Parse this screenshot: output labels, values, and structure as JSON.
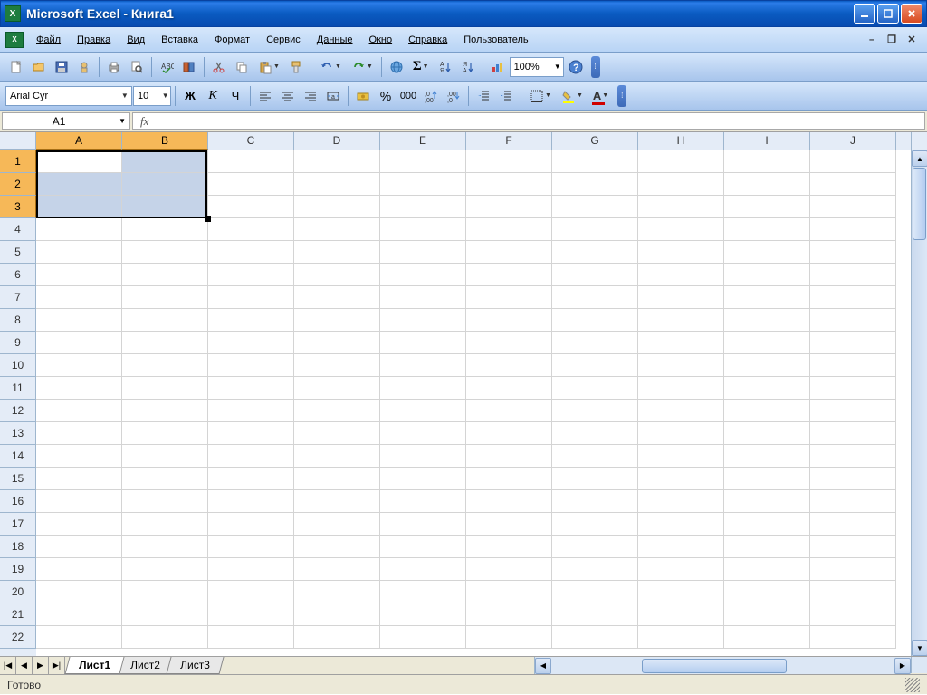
{
  "title": "Microsoft Excel - Книга1",
  "menu": {
    "items": [
      "Файл",
      "Правка",
      "Вид",
      "Вставка",
      "Формат",
      "Сервис",
      "Данные",
      "Окно",
      "Справка",
      "Пользователь"
    ]
  },
  "toolbar1": {
    "zoom": "100%"
  },
  "toolbar2": {
    "font": "Arial Cyr",
    "size": "10",
    "bold": "Ж",
    "italic": "К",
    "underline": "Ч",
    "percent": "%",
    "thousands": "000"
  },
  "namebox": "A1",
  "fx_label": "fx",
  "columns": [
    "A",
    "B",
    "C",
    "D",
    "E",
    "F",
    "G",
    "H",
    "I",
    "J"
  ],
  "selected_cols": [
    "A",
    "B"
  ],
  "rows_visible": 22,
  "selected_rows": [
    1,
    2,
    3
  ],
  "active_cell": "A1",
  "sheets": {
    "active": "Лист1",
    "tabs": [
      "Лист1",
      "Лист2",
      "Лист3"
    ]
  },
  "status": "Готово"
}
